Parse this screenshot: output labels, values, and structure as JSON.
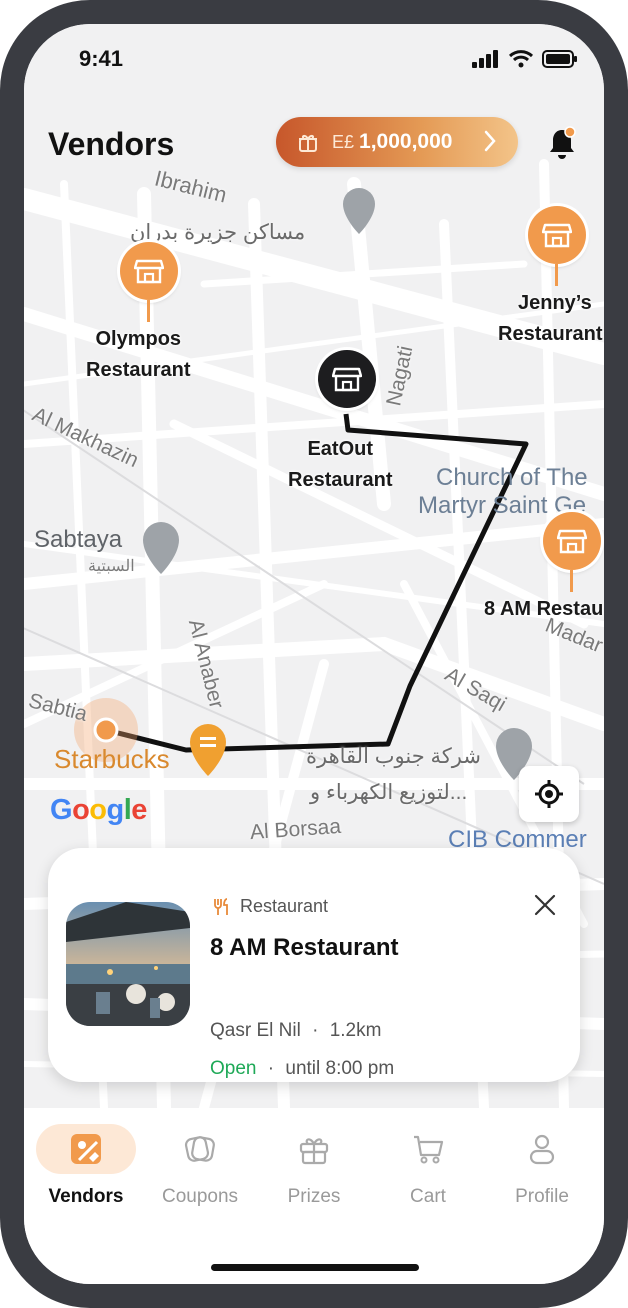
{
  "status_bar": {
    "time": "9:41"
  },
  "header": {
    "title": "Vendors",
    "balance": {
      "currency": "E£",
      "amount": "1,000,000"
    }
  },
  "map": {
    "vendors": [
      {
        "name": "Olympos Restaurant",
        "line1": "Olympos",
        "line2": "Restaurant"
      },
      {
        "name": "EatOut Restaurant",
        "line1": "EatOut",
        "line2": "Restaurant"
      },
      {
        "name": "Jenny's Restaurant",
        "line1": "Jenny’s",
        "line2": "Restaurant"
      },
      {
        "name": "8 AM Restaurant",
        "line1": "8 AM Restau"
      }
    ],
    "labels": {
      "eyn_ibrahim": "Ibrahim",
      "masaken": "مساكن جزيرة بدران",
      "makhazin": "Al Makhazin",
      "nagati": "Nagati",
      "church1": "Church of The",
      "church2": "Martyr Saint Ge",
      "sabtaya": "Sabtaya",
      "sabtaya_ar": "السبتية",
      "anaber": "Al Anaber",
      "madar": "Madar",
      "saqi": "Al Saqi",
      "sabtia": "Sabtia",
      "starbucks": "Starbucks",
      "elec_ar1": "شركة جنوب القاهرة",
      "elec_ar2": "لتوزيع الكهرباء و...",
      "borsaa": "Al Borsaa",
      "cib": "CIB Commer"
    },
    "google_logo": "Google"
  },
  "card": {
    "category": "Restaurant",
    "name": "8 AM Restaurant",
    "area": "Qasr El Nil",
    "distance": "1.2km",
    "status": "Open",
    "hours": "until 8:00 pm"
  },
  "tabs": [
    {
      "label": "Vendors",
      "icon": "map-tag-icon",
      "active": true
    },
    {
      "label": "Coupons",
      "icon": "coupon-icon",
      "active": false
    },
    {
      "label": "Prizes",
      "icon": "gift-icon",
      "active": false
    },
    {
      "label": "Cart",
      "icon": "cart-icon",
      "active": false
    },
    {
      "label": "Profile",
      "icon": "person-icon",
      "active": false
    }
  ],
  "colors": {
    "accent": "#f19a4c",
    "route": "#111111",
    "open": "#1ea957"
  }
}
